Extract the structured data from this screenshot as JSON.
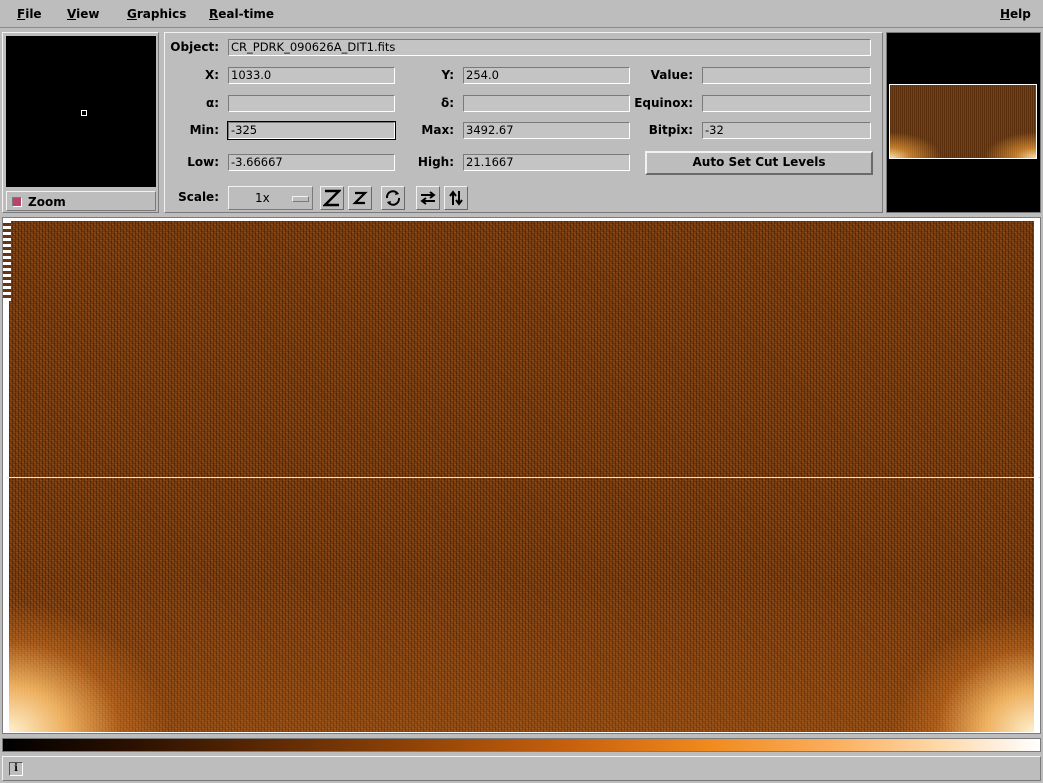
{
  "menubar": {
    "file": "File",
    "view": "View",
    "graphics": "Graphics",
    "realtime": "Real-time",
    "help": "Help"
  },
  "zoom": {
    "label": "Zoom",
    "checked": true
  },
  "info": {
    "object_label": "Object:",
    "object_value": "CR_PDRK_090626A_DIT1.fits",
    "x_label": "X:",
    "x_value": "1033.0",
    "y_label": "Y:",
    "y_value": "254.0",
    "value_label": "Value:",
    "value_value": "",
    "alpha_label": "α:",
    "alpha_value": "",
    "delta_label": "δ:",
    "delta_value": "",
    "equinox_label": "Equinox:",
    "equinox_value": "",
    "min_label": "Min:",
    "min_value": "-325",
    "max_label": "Max:",
    "max_value": "3492.67",
    "bitpix_label": "Bitpix:",
    "bitpix_value": "-32",
    "low_label": "Low:",
    "low_value": "-3.66667",
    "high_label": "High:",
    "high_value": "21.1667",
    "autoset_label": "Auto Set Cut Levels",
    "scale_label": "Scale:",
    "scale_value": "1x"
  },
  "toolbar_icons": [
    "zoom-out-icon",
    "zoom-in-icon",
    "rotate-icon",
    "flip-x-icon",
    "flip-y-icon"
  ],
  "colors": {
    "background": "#bdbdbd",
    "image_base": "#7d3f12",
    "colormap": "heat"
  },
  "status": {
    "text": ""
  }
}
